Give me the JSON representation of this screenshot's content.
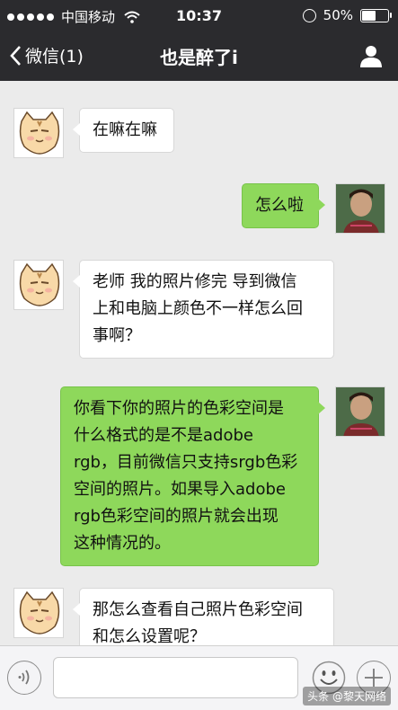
{
  "status_bar": {
    "carrier": "中国移动",
    "time": "10:37",
    "battery_percent_label": "50%",
    "battery_level": 0.5
  },
  "nav_bar": {
    "back_label": "微信(1)",
    "title": "也是醉了i",
    "profile_icon": "person-icon"
  },
  "messages": [
    {
      "from": "contact",
      "text": "在嘛在嘛"
    },
    {
      "from": "me",
      "text": "怎么啦"
    },
    {
      "from": "contact",
      "text": "老师 我的照片修完 导到微信\n上和电脑上颜色不一样怎么回\n事啊？"
    },
    {
      "from": "me",
      "text": "你看下你的照片的色彩空间是\n什么格式的是不是adobe\nrgb，目前微信只支持srgb色彩\n空间的照片。如果导入adobe\nrgb色彩空间的照片就会出现\n这种情况的。"
    },
    {
      "from": "contact",
      "text": "那怎么查看自己照片色彩空间\n和怎么设置呢？"
    }
  ],
  "input_bar": {
    "voice_icon": "voice-icon",
    "emoji_icon": "emoji-icon",
    "plus_icon": "plus-icon"
  },
  "watermark": "头条 @黎天网络",
  "colors": {
    "header_bg": "#2b2b2e",
    "chat_bg": "#ebebeb",
    "outgoing_bubble": "#8ed85b",
    "incoming_bubble": "#ffffff"
  }
}
